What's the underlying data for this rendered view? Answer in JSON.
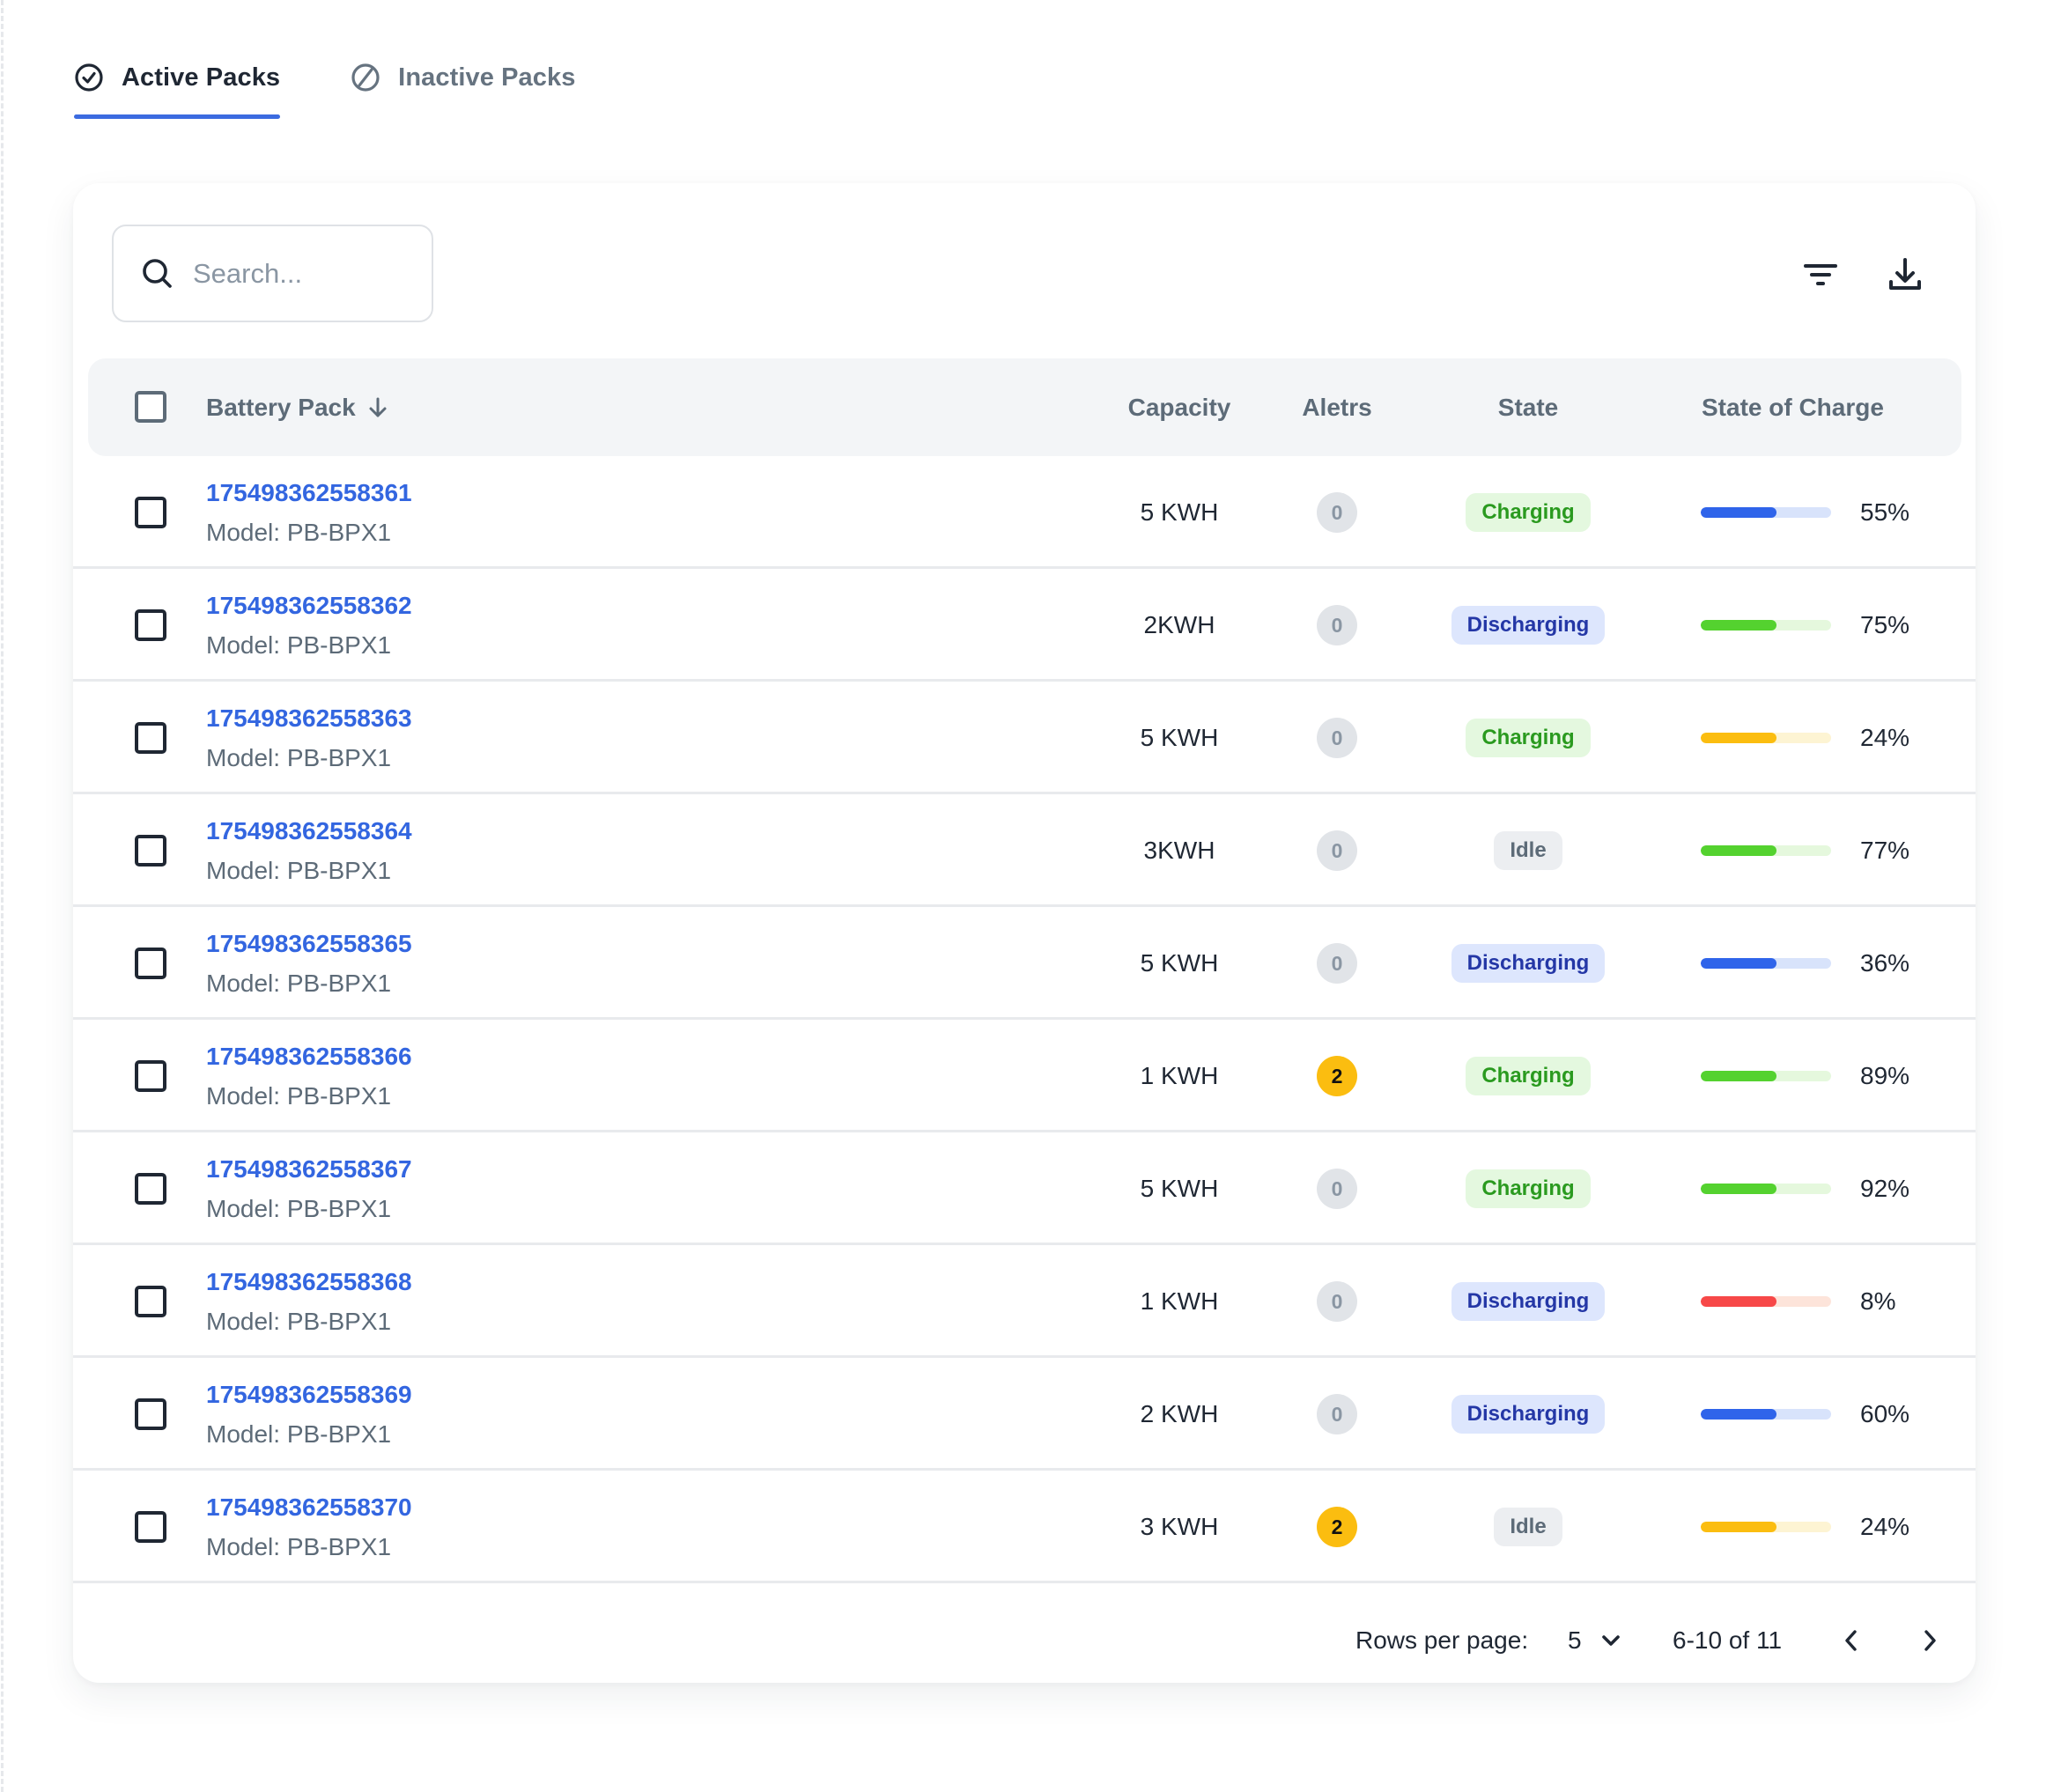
{
  "tabs": [
    {
      "label": "Active Packs",
      "icon": "check-circle-icon",
      "active": true
    },
    {
      "label": "Inactive Packs",
      "icon": "ban-circle-icon",
      "active": false
    }
  ],
  "toolbar": {
    "search_placeholder": "Search...",
    "search_value": "",
    "filter_icon": "filter-icon",
    "download_icon": "download-icon"
  },
  "table": {
    "columns": {
      "battery_pack": "Battery Pack",
      "capacity": "Capacity",
      "alerts": "Aletrs",
      "state": "State",
      "state_of_charge": "State of Charge"
    },
    "sort": {
      "column": "battery_pack",
      "direction": "desc",
      "icon": "arrow-down-icon"
    },
    "rows": [
      {
        "id": "175498362558361",
        "model": "Model: PB-BPX1",
        "capacity": "5 KWH",
        "alerts": "0",
        "state": "Charging",
        "soc": "55%",
        "soc_color": "#2f64ea",
        "soc_track": "#d8e3fb"
      },
      {
        "id": "175498362558362",
        "model": "Model: PB-BPX1",
        "capacity": "2KWH",
        "alerts": "0",
        "state": "Discharging",
        "soc": "75%",
        "soc_color": "#54d22f",
        "soc_track": "#e5f8dd"
      },
      {
        "id": "175498362558363",
        "model": "Model: PB-BPX1",
        "capacity": "5 KWH",
        "alerts": "0",
        "state": "Charging",
        "soc": "24%",
        "soc_color": "#fbbd10",
        "soc_track": "#fdf4d3"
      },
      {
        "id": "175498362558364",
        "model": "Model: PB-BPX1",
        "capacity": "3KWH",
        "alerts": "0",
        "state": "Idle",
        "soc": "77%",
        "soc_color": "#54d22f",
        "soc_track": "#e5f8dd"
      },
      {
        "id": "175498362558365",
        "model": "Model: PB-BPX1",
        "capacity": "5 KWH",
        "alerts": "0",
        "state": "Discharging",
        "soc": "36%",
        "soc_color": "#2f64ea",
        "soc_track": "#d8e3fb"
      },
      {
        "id": "175498362558366",
        "model": "Model: PB-BPX1",
        "capacity": "1 KWH",
        "alerts": "2",
        "state": "Charging",
        "soc": "89%",
        "soc_color": "#54d22f",
        "soc_track": "#e5f8dd"
      },
      {
        "id": "175498362558367",
        "model": "Model: PB-BPX1",
        "capacity": "5 KWH",
        "alerts": "0",
        "state": "Charging",
        "soc": "92%",
        "soc_color": "#54d22f",
        "soc_track": "#e5f8dd"
      },
      {
        "id": "175498362558368",
        "model": "Model: PB-BPX1",
        "capacity": "1 KWH",
        "alerts": "0",
        "state": "Discharging",
        "soc": "8%",
        "soc_color": "#f74848",
        "soc_track": "#fde4da"
      },
      {
        "id": "175498362558369",
        "model": "Model: PB-BPX1",
        "capacity": "2 KWH",
        "alerts": "0",
        "state": "Discharging",
        "soc": "60%",
        "soc_color": "#2f64ea",
        "soc_track": "#d8e3fb"
      },
      {
        "id": "175498362558370",
        "model": "Model: PB-BPX1",
        "capacity": "3 KWH",
        "alerts": "2",
        "state": "Idle",
        "soc": "24%",
        "soc_color": "#fbbd10",
        "soc_track": "#fdf4d3"
      }
    ]
  },
  "pagination": {
    "rows_per_page_label": "Rows per page:",
    "rows_per_page_value": "5",
    "range": "6-10 of 11"
  },
  "colors": {
    "accent": "#3b6be0",
    "link": "#3366e0",
    "charging_text": "#2a9a1f",
    "discharging_text": "#2437a6",
    "alert_warning": "#fbbd10"
  }
}
